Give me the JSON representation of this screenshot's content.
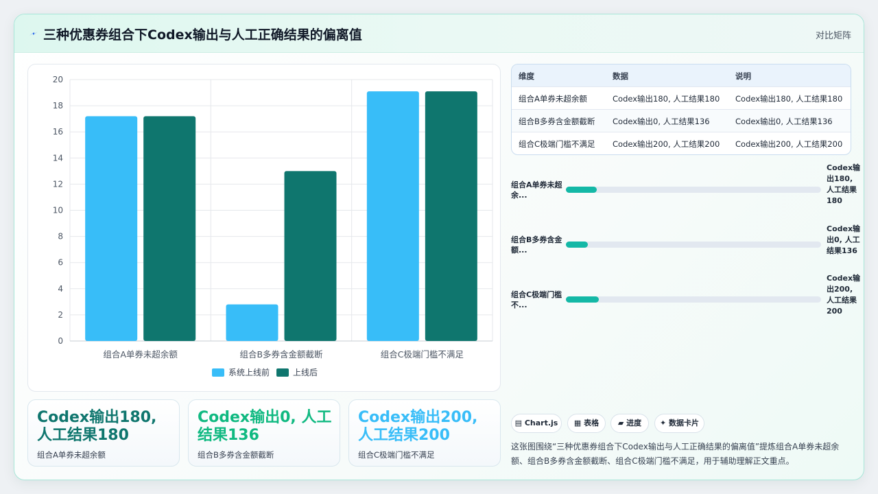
{
  "header": {
    "title": "三种优惠券组合下Codex输出与人工正确结果的偏离值",
    "right_label": "对比矩阵",
    "icon": "lightning-icon"
  },
  "chart_data": {
    "type": "bar",
    "categories": [
      "组合A单券未超余额",
      "组合B多券含金额截断",
      "组合C极端门槛不满足"
    ],
    "series": [
      {
        "name": "系统上线前",
        "values": [
          17.2,
          2.8,
          19.1
        ],
        "color": "#38bdf8"
      },
      {
        "name": "上线后",
        "values": [
          17.2,
          13.0,
          19.1
        ],
        "color": "#0f766e"
      }
    ],
    "ylim": [
      0,
      20
    ],
    "yticks": [
      0,
      2,
      4,
      6,
      8,
      10,
      12,
      14,
      16,
      18,
      20
    ],
    "grid": true,
    "legend": "bottom"
  },
  "table": {
    "headers": [
      "维度",
      "数据",
      "说明"
    ],
    "rows": [
      [
        "组合A单券未超余额",
        "Codex输出180, 人工结果180",
        "Codex输出180, 人工结果180"
      ],
      [
        "组合B多券含金额截断",
        "Codex输出0, 人工结果136",
        "Codex输出0, 人工结果136"
      ],
      [
        "组合C极端门槛不满足",
        "Codex输出200, 人工结果200",
        "Codex输出200, 人工结果200"
      ]
    ]
  },
  "progress": [
    {
      "label": "组合A单券未超余...",
      "value": "Codex输出180, 人工结果180",
      "fraction": 0.12
    },
    {
      "label": "组合B多券含金额...",
      "value": "Codex输出0, 人工结果136",
      "fraction": 0.085
    },
    {
      "label": "组合C极端门槛不...",
      "value": "Codex输出200, 人工结果200",
      "fraction": 0.13
    }
  ],
  "kpis": [
    {
      "value": "Codex输出180, 人工结果180",
      "label": "组合A单券未超余额",
      "color": "#0f766e"
    },
    {
      "value": "Codex输出0, 人工结果136",
      "label": "组合B多券含金额截断",
      "color": "#10b981"
    },
    {
      "value": "Codex输出200, 人工结果200",
      "label": "组合C极端门槛不满足",
      "color": "#38bdf8"
    }
  ],
  "tags": [
    {
      "label": "▤ Chart.js"
    },
    {
      "label": "▦ 表格"
    },
    {
      "label": "▰ 进度"
    },
    {
      "label": "✦ 数据卡片"
    }
  ],
  "caption": "这张图围绕“三种优惠券组合下Codex输出与人工正确结果的偏离值”提炼组合A单券未超余额、组合B多券含金额截断、组合C极端门槛不满足，用于辅助理解正文重点。"
}
